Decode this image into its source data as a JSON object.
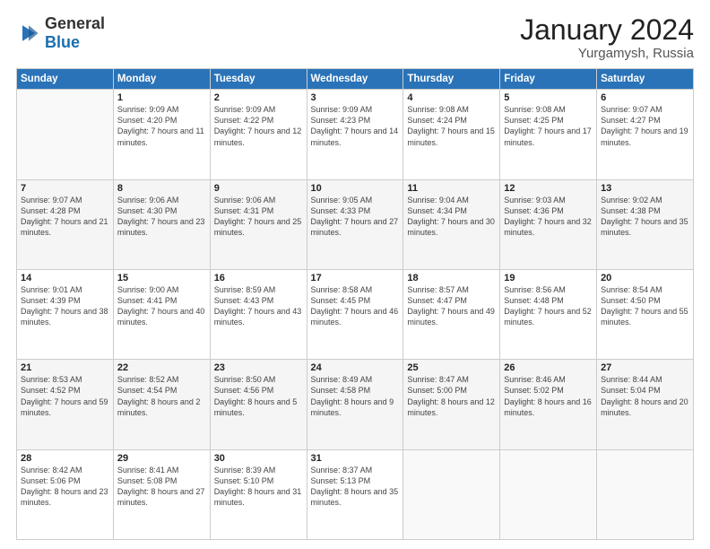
{
  "logo": {
    "text_general": "General",
    "text_blue": "Blue"
  },
  "header": {
    "month": "January 2024",
    "location": "Yurgamysh, Russia"
  },
  "days_of_week": [
    "Sunday",
    "Monday",
    "Tuesday",
    "Wednesday",
    "Thursday",
    "Friday",
    "Saturday"
  ],
  "weeks": [
    [
      {
        "day": "",
        "sunrise": "",
        "sunset": "",
        "daylight": ""
      },
      {
        "day": "1",
        "sunrise": "9:09 AM",
        "sunset": "4:20 PM",
        "daylight": "7 hours and 11 minutes."
      },
      {
        "day": "2",
        "sunrise": "9:09 AM",
        "sunset": "4:22 PM",
        "daylight": "7 hours and 12 minutes."
      },
      {
        "day": "3",
        "sunrise": "9:09 AM",
        "sunset": "4:23 PM",
        "daylight": "7 hours and 14 minutes."
      },
      {
        "day": "4",
        "sunrise": "9:08 AM",
        "sunset": "4:24 PM",
        "daylight": "7 hours and 15 minutes."
      },
      {
        "day": "5",
        "sunrise": "9:08 AM",
        "sunset": "4:25 PM",
        "daylight": "7 hours and 17 minutes."
      },
      {
        "day": "6",
        "sunrise": "9:07 AM",
        "sunset": "4:27 PM",
        "daylight": "7 hours and 19 minutes."
      }
    ],
    [
      {
        "day": "7",
        "sunrise": "9:07 AM",
        "sunset": "4:28 PM",
        "daylight": "7 hours and 21 minutes."
      },
      {
        "day": "8",
        "sunrise": "9:06 AM",
        "sunset": "4:30 PM",
        "daylight": "7 hours and 23 minutes."
      },
      {
        "day": "9",
        "sunrise": "9:06 AM",
        "sunset": "4:31 PM",
        "daylight": "7 hours and 25 minutes."
      },
      {
        "day": "10",
        "sunrise": "9:05 AM",
        "sunset": "4:33 PM",
        "daylight": "7 hours and 27 minutes."
      },
      {
        "day": "11",
        "sunrise": "9:04 AM",
        "sunset": "4:34 PM",
        "daylight": "7 hours and 30 minutes."
      },
      {
        "day": "12",
        "sunrise": "9:03 AM",
        "sunset": "4:36 PM",
        "daylight": "7 hours and 32 minutes."
      },
      {
        "day": "13",
        "sunrise": "9:02 AM",
        "sunset": "4:38 PM",
        "daylight": "7 hours and 35 minutes."
      }
    ],
    [
      {
        "day": "14",
        "sunrise": "9:01 AM",
        "sunset": "4:39 PM",
        "daylight": "7 hours and 38 minutes."
      },
      {
        "day": "15",
        "sunrise": "9:00 AM",
        "sunset": "4:41 PM",
        "daylight": "7 hours and 40 minutes."
      },
      {
        "day": "16",
        "sunrise": "8:59 AM",
        "sunset": "4:43 PM",
        "daylight": "7 hours and 43 minutes."
      },
      {
        "day": "17",
        "sunrise": "8:58 AM",
        "sunset": "4:45 PM",
        "daylight": "7 hours and 46 minutes."
      },
      {
        "day": "18",
        "sunrise": "8:57 AM",
        "sunset": "4:47 PM",
        "daylight": "7 hours and 49 minutes."
      },
      {
        "day": "19",
        "sunrise": "8:56 AM",
        "sunset": "4:48 PM",
        "daylight": "7 hours and 52 minutes."
      },
      {
        "day": "20",
        "sunrise": "8:54 AM",
        "sunset": "4:50 PM",
        "daylight": "7 hours and 55 minutes."
      }
    ],
    [
      {
        "day": "21",
        "sunrise": "8:53 AM",
        "sunset": "4:52 PM",
        "daylight": "7 hours and 59 minutes."
      },
      {
        "day": "22",
        "sunrise": "8:52 AM",
        "sunset": "4:54 PM",
        "daylight": "8 hours and 2 minutes."
      },
      {
        "day": "23",
        "sunrise": "8:50 AM",
        "sunset": "4:56 PM",
        "daylight": "8 hours and 5 minutes."
      },
      {
        "day": "24",
        "sunrise": "8:49 AM",
        "sunset": "4:58 PM",
        "daylight": "8 hours and 9 minutes."
      },
      {
        "day": "25",
        "sunrise": "8:47 AM",
        "sunset": "5:00 PM",
        "daylight": "8 hours and 12 minutes."
      },
      {
        "day": "26",
        "sunrise": "8:46 AM",
        "sunset": "5:02 PM",
        "daylight": "8 hours and 16 minutes."
      },
      {
        "day": "27",
        "sunrise": "8:44 AM",
        "sunset": "5:04 PM",
        "daylight": "8 hours and 20 minutes."
      }
    ],
    [
      {
        "day": "28",
        "sunrise": "8:42 AM",
        "sunset": "5:06 PM",
        "daylight": "8 hours and 23 minutes."
      },
      {
        "day": "29",
        "sunrise": "8:41 AM",
        "sunset": "5:08 PM",
        "daylight": "8 hours and 27 minutes."
      },
      {
        "day": "30",
        "sunrise": "8:39 AM",
        "sunset": "5:10 PM",
        "daylight": "8 hours and 31 minutes."
      },
      {
        "day": "31",
        "sunrise": "8:37 AM",
        "sunset": "5:13 PM",
        "daylight": "8 hours and 35 minutes."
      },
      {
        "day": "",
        "sunrise": "",
        "sunset": "",
        "daylight": ""
      },
      {
        "day": "",
        "sunrise": "",
        "sunset": "",
        "daylight": ""
      },
      {
        "day": "",
        "sunrise": "",
        "sunset": "",
        "daylight": ""
      }
    ]
  ]
}
